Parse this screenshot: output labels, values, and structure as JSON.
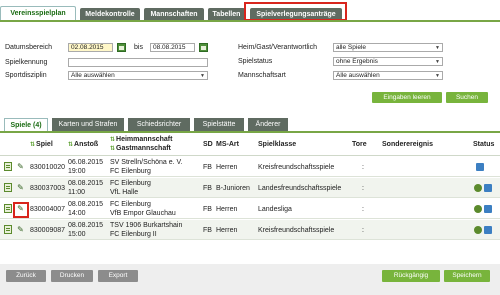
{
  "top_tabs": [
    "Vereinsspielplan",
    "Meldekontrolle",
    "Mannschaften",
    "Tabellen",
    "Spielverlegungsanträge"
  ],
  "filter": {
    "datumsbereich_label": "Datumsbereich",
    "date_from": "02.08.2015",
    "bis_label": "bis",
    "date_to": "08.08.2015",
    "spielkennung_label": "Spielkennung",
    "spielkennung_value": "",
    "sportdisziplin_label": "Sportdisziplin",
    "sportdisziplin_value": "Alle auswählen",
    "heim_label": "Heim/Gast/Verantwortlich",
    "heim_value": "alle Spiele",
    "spielstatus_label": "Spielstatus",
    "spielstatus_value": "ohne Ergebnis",
    "mannschaftsart_label": "Mannschaftsart",
    "mannschaftsart_value": "Alle auswählen",
    "clear_label": "Eingaben leeren",
    "search_label": "Suchen"
  },
  "sub_tabs": [
    "Spiele (4)",
    "Karten und Strafen",
    "Schiedsrichter",
    "Spielstätte",
    "Änderer"
  ],
  "table": {
    "headers": {
      "spiel": "Spiel",
      "anstoss": "Anstoß",
      "heim": "Heimmannschaft",
      "gast": "Gastmannschaft",
      "sd": "SD",
      "ms_art": "MS-Art",
      "spielklasse": "Spielklasse",
      "tore": "Tore",
      "sonder": "Sonderereignis",
      "status": "Status"
    },
    "rows": [
      {
        "spiel": "830010020",
        "date": "06.08.2015",
        "time": "19:00",
        "heim": "SV Strelln/Schöna e. V.",
        "gast": "FC Eilenburg",
        "sd": "FB",
        "ms_art": "Herren",
        "spielklasse": "Kreisfreundschaftsspiele",
        "tore": ":"
      },
      {
        "spiel": "830037003",
        "date": "08.08.2015",
        "time": "11:00",
        "heim": "FC Eilenburg",
        "gast": "VfL Halle",
        "sd": "FB",
        "ms_art": "B-Junioren",
        "spielklasse": "Landesfreundschaftsspiele",
        "tore": ":"
      },
      {
        "spiel": "830004007",
        "date": "08.08.2015",
        "time": "14:00",
        "heim": "FC Eilenburg",
        "gast": "VfB Empor Glauchau",
        "sd": "FB",
        "ms_art": "Herren",
        "spielklasse": "Landesliga",
        "tore": ":"
      },
      {
        "spiel": "830009087",
        "date": "08.08.2015",
        "time": "15:00",
        "heim": "TSV 1906 Burkartshain",
        "gast": "FC Eilenburg II",
        "sd": "FB",
        "ms_art": "Herren",
        "spielklasse": "Kreisfreundschaftsspiele",
        "tore": ":"
      }
    ]
  },
  "bottom": {
    "zurueck": "Zurück",
    "drucken": "Drucken",
    "export": "Export",
    "rueckgaengig": "Rückgängig",
    "speichern": "Speichern"
  }
}
